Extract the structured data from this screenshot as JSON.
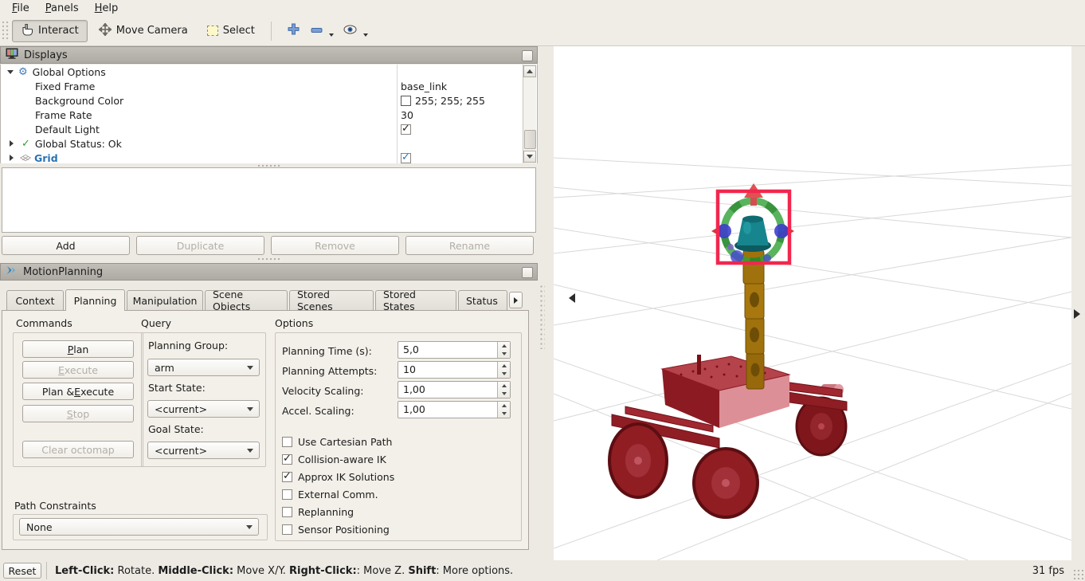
{
  "menu": {
    "items": [
      {
        "label": "File"
      },
      {
        "label": "Panels"
      },
      {
        "label": "Help"
      }
    ]
  },
  "toolbar": {
    "interact": {
      "label": "Interact"
    },
    "move_camera": {
      "label": "Move Camera"
    },
    "select": {
      "label": "Select"
    }
  },
  "displays": {
    "title": "Displays",
    "tree": {
      "global_options": {
        "label": "Global Options"
      },
      "fixed_frame": {
        "label": "Fixed Frame",
        "value": "base_link"
      },
      "background_color": {
        "label": "Background Color",
        "value": "255; 255; 255"
      },
      "frame_rate": {
        "label": "Frame Rate",
        "value": "30"
      },
      "default_light": {
        "label": "Default Light",
        "checked": true
      },
      "global_status": {
        "label": "Global Status: Ok"
      },
      "grid": {
        "label": "Grid",
        "checked": true
      }
    },
    "buttons": {
      "add": {
        "label": "Add",
        "enabled": true
      },
      "duplicate": {
        "label": "Duplicate",
        "enabled": false
      },
      "remove": {
        "label": "Remove",
        "enabled": false
      },
      "rename": {
        "label": "Rename",
        "enabled": false
      }
    }
  },
  "motion_planning": {
    "title": "MotionPlanning",
    "tabs": [
      {
        "label": "Context",
        "active": false
      },
      {
        "label": "Planning",
        "active": true
      },
      {
        "label": "Manipulation",
        "active": false
      },
      {
        "label": "Scene Objects",
        "active": false
      },
      {
        "label": "Stored Scenes",
        "active": false
      },
      {
        "label": "Stored States",
        "active": false
      },
      {
        "label": "Status",
        "active": false
      }
    ],
    "sections": {
      "commands": "Commands",
      "query": "Query",
      "options": "Options"
    },
    "commands": {
      "plan": {
        "label": "Plan",
        "enabled": true
      },
      "execute": {
        "label": "Execute",
        "enabled": false
      },
      "plan_execute": {
        "label": "Plan & Execute",
        "enabled": true
      },
      "stop": {
        "label": "Stop",
        "enabled": false
      },
      "clear_octomap": {
        "label": "Clear octomap",
        "enabled": false
      }
    },
    "query": {
      "planning_group": {
        "label": "Planning Group:",
        "value": "arm"
      },
      "start_state": {
        "label": "Start State:",
        "value": "<current>"
      },
      "goal_state": {
        "label": "Goal State:",
        "value": "<current>"
      }
    },
    "options": {
      "planning_time": {
        "label": "Planning Time (s):",
        "value": "5,0"
      },
      "planning_attempts": {
        "label": "Planning Attempts:",
        "value": "10"
      },
      "velocity_scaling": {
        "label": "Velocity Scaling:",
        "value": "1,00"
      },
      "accel_scaling": {
        "label": "Accel. Scaling:",
        "value": "1,00"
      },
      "checkboxes": [
        {
          "label": "Use Cartesian Path",
          "checked": false
        },
        {
          "label": "Collision-aware IK",
          "checked": true
        },
        {
          "label": "Approx IK Solutions",
          "checked": true
        },
        {
          "label": "External Comm.",
          "checked": false
        },
        {
          "label": "Replanning",
          "checked": false
        },
        {
          "label": "Sensor Positioning",
          "checked": false
        }
      ]
    },
    "path_constraints": {
      "label": "Path Constraints",
      "value": "None"
    }
  },
  "viewport": {
    "fps": "31 fps"
  },
  "statusbar": {
    "reset": "Reset",
    "hints": [
      {
        "text": "Left-Click:",
        "bold": true
      },
      {
        "text": " Rotate. ",
        "bold": false
      },
      {
        "text": "Middle-Click:",
        "bold": true
      },
      {
        "text": " Move X/Y. ",
        "bold": false
      },
      {
        "text": "Right-Click:",
        "bold": true
      },
      {
        "text": ": Move Z. ",
        "bold": false
      },
      {
        "text": "Shift",
        "bold": true
      },
      {
        "text": ": More options.",
        "bold": false
      }
    ]
  },
  "colors": {
    "link_blue": "#2873b4",
    "marker_red": "#f2274e",
    "robot_red": "#8f1d24",
    "arm_gold": "#a0720d",
    "effector_teal": "#17858d",
    "ring_green": "#31a035",
    "handle_blue": "#3b3bcf",
    "status_green": "#2e9e2e",
    "background_white": "#ffffff"
  }
}
